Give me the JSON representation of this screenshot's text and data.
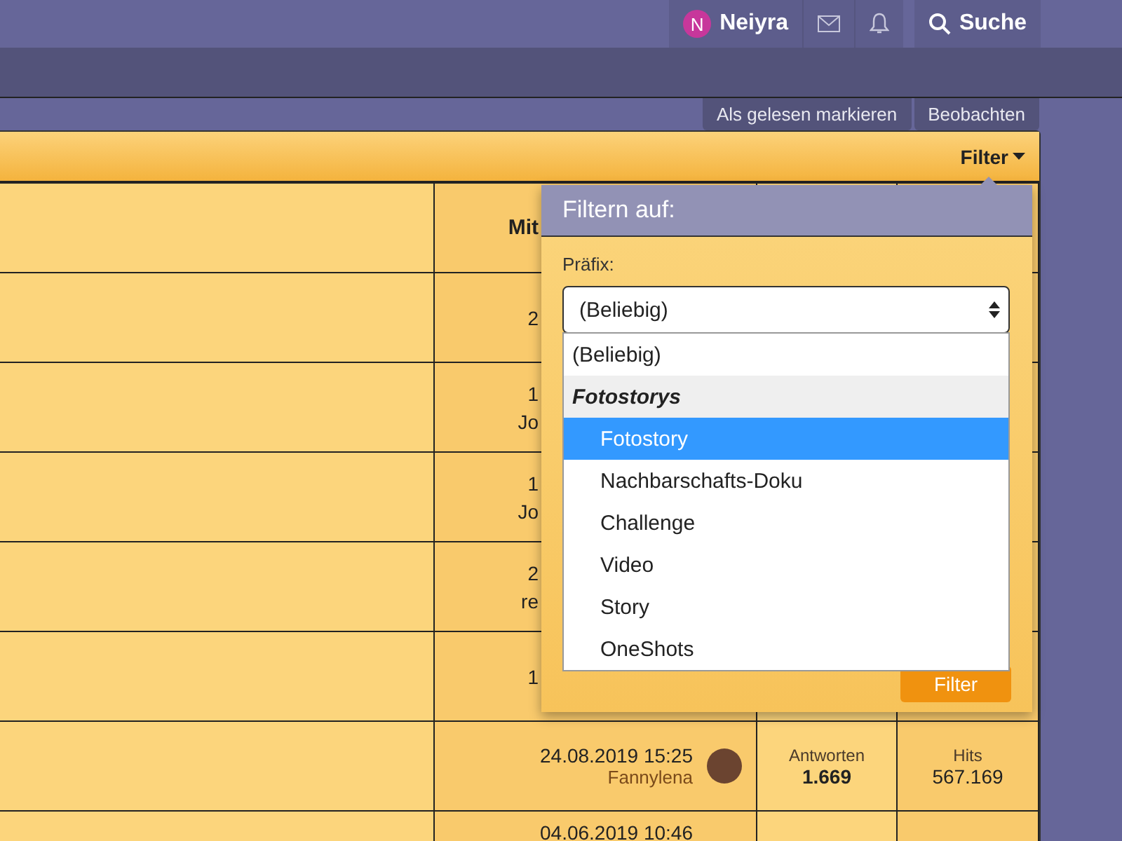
{
  "header": {
    "user": {
      "initial": "N",
      "name": "Neiyra"
    },
    "search_label": "Suche"
  },
  "actions": [
    "Als gelesen markieren",
    "Beobachten"
  ],
  "thread_list": {
    "filter_label": "Filter",
    "rows": [
      {
        "kind": "heading",
        "lines": [
          "Mit"
        ]
      },
      {
        "kind": "covered",
        "lines": [
          "2"
        ]
      },
      {
        "kind": "covered",
        "lines": [
          "1",
          "Jo"
        ]
      },
      {
        "kind": "covered",
        "lines": [
          "1",
          "Jo"
        ]
      },
      {
        "kind": "covered",
        "lines": [
          "2",
          "re"
        ]
      },
      {
        "kind": "covered",
        "lines": [
          "1"
        ]
      },
      {
        "kind": "full",
        "date": "24.08.2019 15:25",
        "author": "Fannylena",
        "replies_label": "Antworten",
        "replies": "1.669",
        "hits_label": "Hits",
        "hits": "567.169"
      },
      {
        "kind": "partial",
        "date": "04.06.2019 10:46"
      }
    ]
  },
  "filter_popup": {
    "title": "Filtern auf:",
    "field_label": "Präfix:",
    "select_value": "(Beliebig)",
    "submit": "Filter",
    "options": [
      {
        "kind": "option",
        "label": "(Beliebig)",
        "selected": false
      },
      {
        "kind": "group",
        "label": "Fotostorys",
        "selected": false
      },
      {
        "kind": "child",
        "label": "Fotostory",
        "selected": true
      },
      {
        "kind": "child",
        "label": "Nachbarschafts-Doku",
        "selected": false
      },
      {
        "kind": "child",
        "label": "Challenge",
        "selected": false
      },
      {
        "kind": "child",
        "label": "Video",
        "selected": false
      },
      {
        "kind": "child",
        "label": "Story",
        "selected": false
      },
      {
        "kind": "child",
        "label": "OneShots",
        "selected": false
      }
    ]
  }
}
